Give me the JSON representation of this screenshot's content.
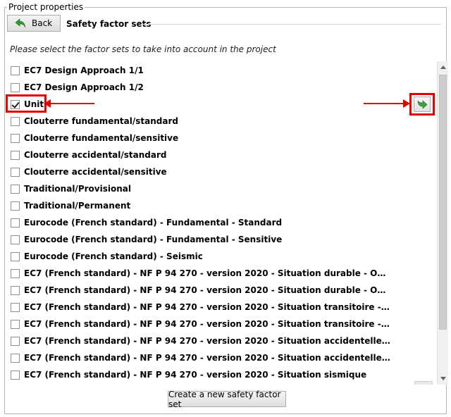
{
  "group": {
    "title": "Project properties"
  },
  "header": {
    "back_label": "Back",
    "section_title": "Safety factor sets",
    "instruction": "Please select the factor sets to take into account in the project"
  },
  "factor_sets": [
    {
      "label": "EC7 Design Approach 1/1",
      "checked": false
    },
    {
      "label": "EC7 Design Approach 1/2",
      "checked": false
    },
    {
      "label": "Unit",
      "checked": true
    },
    {
      "label": "Clouterre fundamental/standard",
      "checked": false
    },
    {
      "label": "Clouterre fundamental/sensitive",
      "checked": false
    },
    {
      "label": "Clouterre accidental/standard",
      "checked": false
    },
    {
      "label": "Clouterre accidental/sensitive",
      "checked": false
    },
    {
      "label": "Traditional/Provisional",
      "checked": false
    },
    {
      "label": "Traditional/Permanent",
      "checked": false
    },
    {
      "label": "Eurocode (French standard) - Fundamental - Standard",
      "checked": false
    },
    {
      "label": "Eurocode (French standard) - Fundamental - Sensitive",
      "checked": false
    },
    {
      "label": "Eurocode (French standard) - Seismic",
      "checked": false
    },
    {
      "label": "EC7 (French standard) - NF P 94 270 - version 2020 - Situation durable - Ouvrage courant",
      "checked": false
    },
    {
      "label": "EC7 (French standard) - NF P 94 270 - version 2020 - Situation durable - Ouvrage sensible",
      "checked": false
    },
    {
      "label": "EC7 (French standard) - NF P 94 270 - version 2020 - Situation transitoire - Ouvrage courant",
      "checked": false
    },
    {
      "label": "EC7 (French standard) - NF P 94 270 - version 2020 - Situation transitoire - Ouvrage sensible",
      "checked": false
    },
    {
      "label": "EC7 (French standard) - NF P 94 270 - version 2020 - Situation accidentelle - Ouvrage cour...",
      "checked": false
    },
    {
      "label": "EC7 (French standard) - NF P 94 270 - version 2020 - Situation accidentelle - Ouvrage sensi...",
      "checked": false
    },
    {
      "label": "EC7 (French standard) - NF P 94 270 - version 2020 - Situation sismique",
      "checked": false
    }
  ],
  "footer": {
    "create_label": "Create a new safety factor set"
  },
  "colors": {
    "highlight": "#e00000",
    "go_arrow": "#3aa33a"
  },
  "icons": {
    "back": "back-arrow-icon",
    "go": "go-arrow-icon"
  }
}
